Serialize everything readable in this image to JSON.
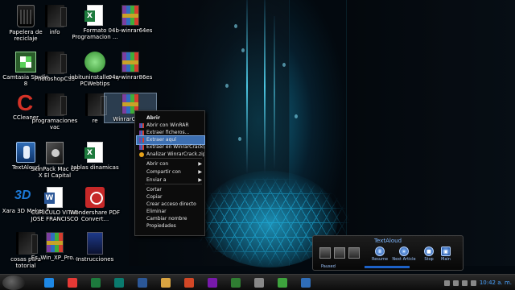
{
  "desktop": {
    "icons": [
      {
        "id": "papelera",
        "label": "Papelera de reciclaje",
        "kind": "bin"
      },
      {
        "id": "info",
        "label": "info",
        "kind": "folder"
      },
      {
        "id": "formato",
        "label": "Formato Programacion ...",
        "kind": "excel"
      },
      {
        "id": "04b-winrar64",
        "label": "04b-winrar64es",
        "kind": "rar"
      },
      {
        "id": "camtasia",
        "label": "Camtasia Studio 8",
        "kind": "camt"
      },
      {
        "id": "photoshop",
        "label": "PhotoshopCS5",
        "kind": "folder"
      },
      {
        "id": "iobit",
        "label": "iobituninstaller by PCWebtips",
        "kind": "iobit"
      },
      {
        "id": "04a-winrar86",
        "label": "04a-winrar86es",
        "kind": "rar"
      },
      {
        "id": "ccleaner",
        "label": "CCleaner",
        "kind": "ccleaner"
      },
      {
        "id": "programaciones",
        "label": "programaciones vac",
        "kind": "folder"
      },
      {
        "id": "re",
        "label": "re",
        "kind": "folder"
      },
      {
        "id": "winrarcrack",
        "label": "WinrarCrack",
        "kind": "rar"
      },
      {
        "id": "textaloud",
        "label": "TextAloud",
        "kind": "textaloud"
      },
      {
        "id": "skinpack",
        "label": "SkinPack Mac OS X El Capital",
        "kind": "skin"
      },
      {
        "id": "tablas",
        "label": "tablas dinamicas",
        "kind": "excel"
      },
      {
        "id": "xara",
        "label": "Xara 3D Maker 7",
        "kind": "xara"
      },
      {
        "id": "curriculo",
        "label": "CURICULO VITAE JOSE FRANCISCO",
        "kind": "word"
      },
      {
        "id": "wondershare",
        "label": "Wondershare PDF Convert...",
        "kind": "pdf"
      },
      {
        "id": "cosas",
        "label": "cosas para totorial",
        "kind": "folder"
      },
      {
        "id": "es-win",
        "label": "Es_Win_XP_Pro...",
        "kind": "rar"
      },
      {
        "id": "instrucciones",
        "label": "Instrucciones",
        "kind": "dark"
      }
    ]
  },
  "context_menu": {
    "items": [
      {
        "label": "Abrir",
        "bold": true
      },
      {
        "label": "Abrir con WinRAR",
        "icon": "rar"
      },
      {
        "label": "Extraer ficheros...",
        "icon": "rar"
      },
      {
        "label": "Extraer aquí",
        "icon": "rar",
        "highlighted": true
      },
      {
        "label": "Extraer en WinrarCrack\\",
        "icon": "rar"
      },
      {
        "label": "Analizar WinrarCrack.zip",
        "icon": "zip"
      },
      {
        "label": "Abrir con",
        "submenu": true
      },
      {
        "label": "Compartir con",
        "submenu": true
      },
      {
        "label": "Enviar a",
        "submenu": true
      },
      {
        "label": "Cortar"
      },
      {
        "label": "Copiar"
      },
      {
        "label": "Crear acceso directo"
      },
      {
        "label": "Eliminar"
      },
      {
        "label": "Cambiar nombre"
      },
      {
        "label": "Propiedades"
      }
    ]
  },
  "textaloud": {
    "title": "TextAloud",
    "status": "Paused",
    "buttons": [
      "Resume",
      "Next Article",
      "Stop",
      "Main"
    ]
  },
  "taskbar": {
    "clock": "10:42 a. m."
  },
  "colors": {
    "highlight": "#3d6fb1",
    "glow": "#58e1ff",
    "clock": "#4aa3ff"
  }
}
